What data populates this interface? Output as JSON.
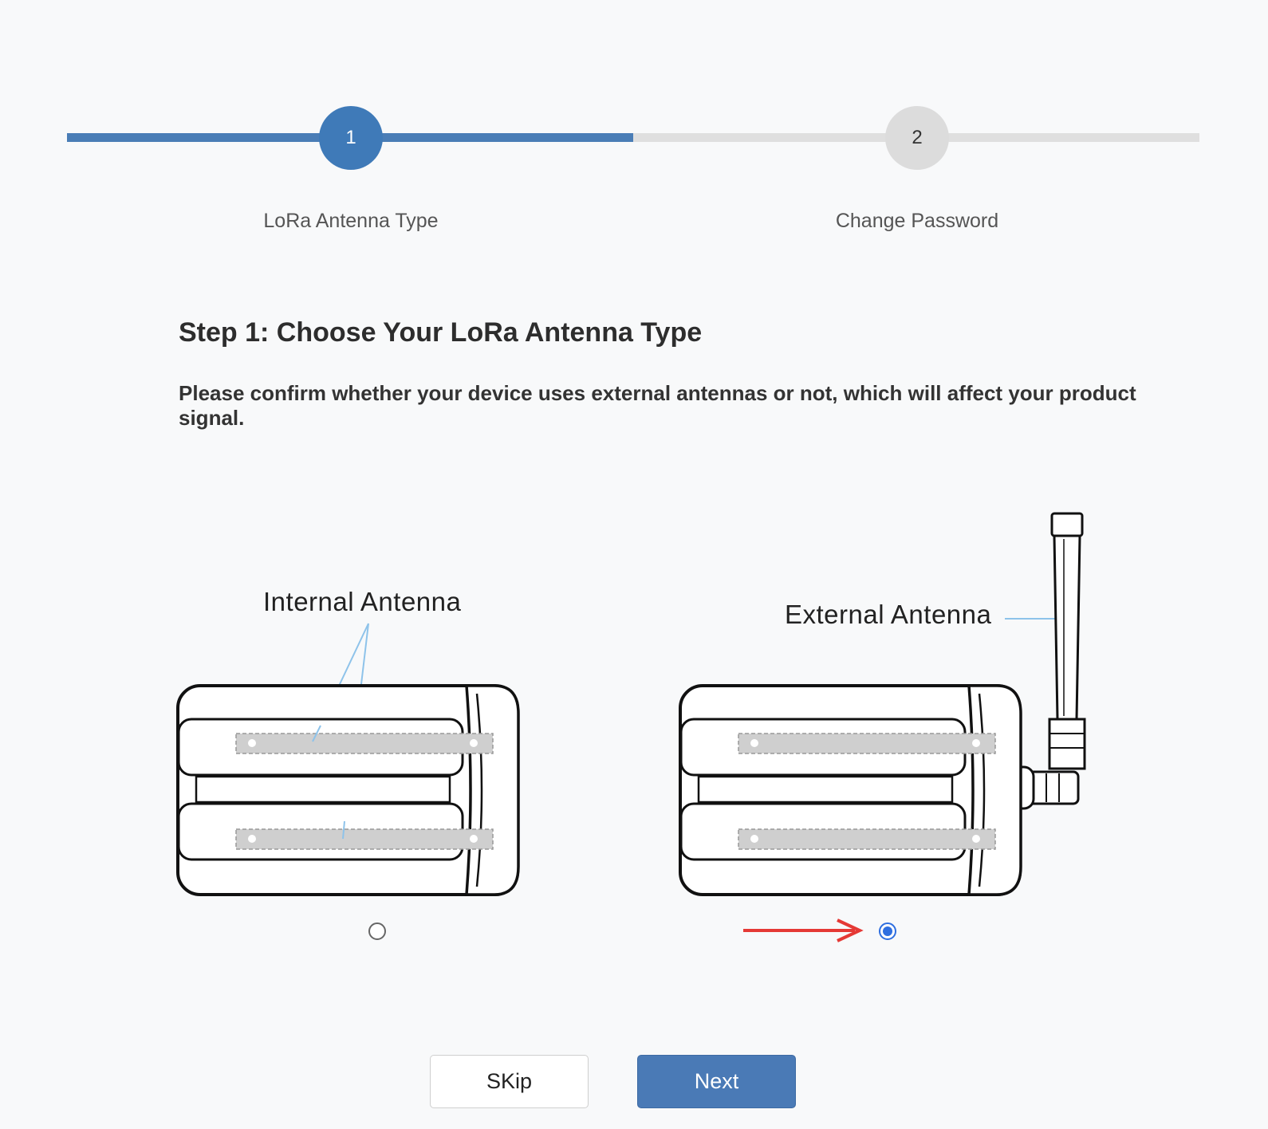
{
  "stepper": {
    "steps": [
      {
        "number": "1",
        "label": "LoRa Antenna Type"
      },
      {
        "number": "2",
        "label": "Change Password"
      }
    ],
    "current_step": 1
  },
  "main": {
    "heading": "Step 1: Choose Your LoRa Antenna Type",
    "description": "Please confirm whether your device uses external antennas or not, which will affect your product signal."
  },
  "options": [
    {
      "label": "Internal Antenna",
      "selected": false
    },
    {
      "label": "External Antenna",
      "selected": true
    }
  ],
  "buttons": {
    "skip": "SKip",
    "next": "Next"
  },
  "colors": {
    "accent": "#4a7db6",
    "radio_selected": "#2f6fe0",
    "annotation_arrow": "#e53935",
    "leader_line": "#8ec3ea"
  }
}
